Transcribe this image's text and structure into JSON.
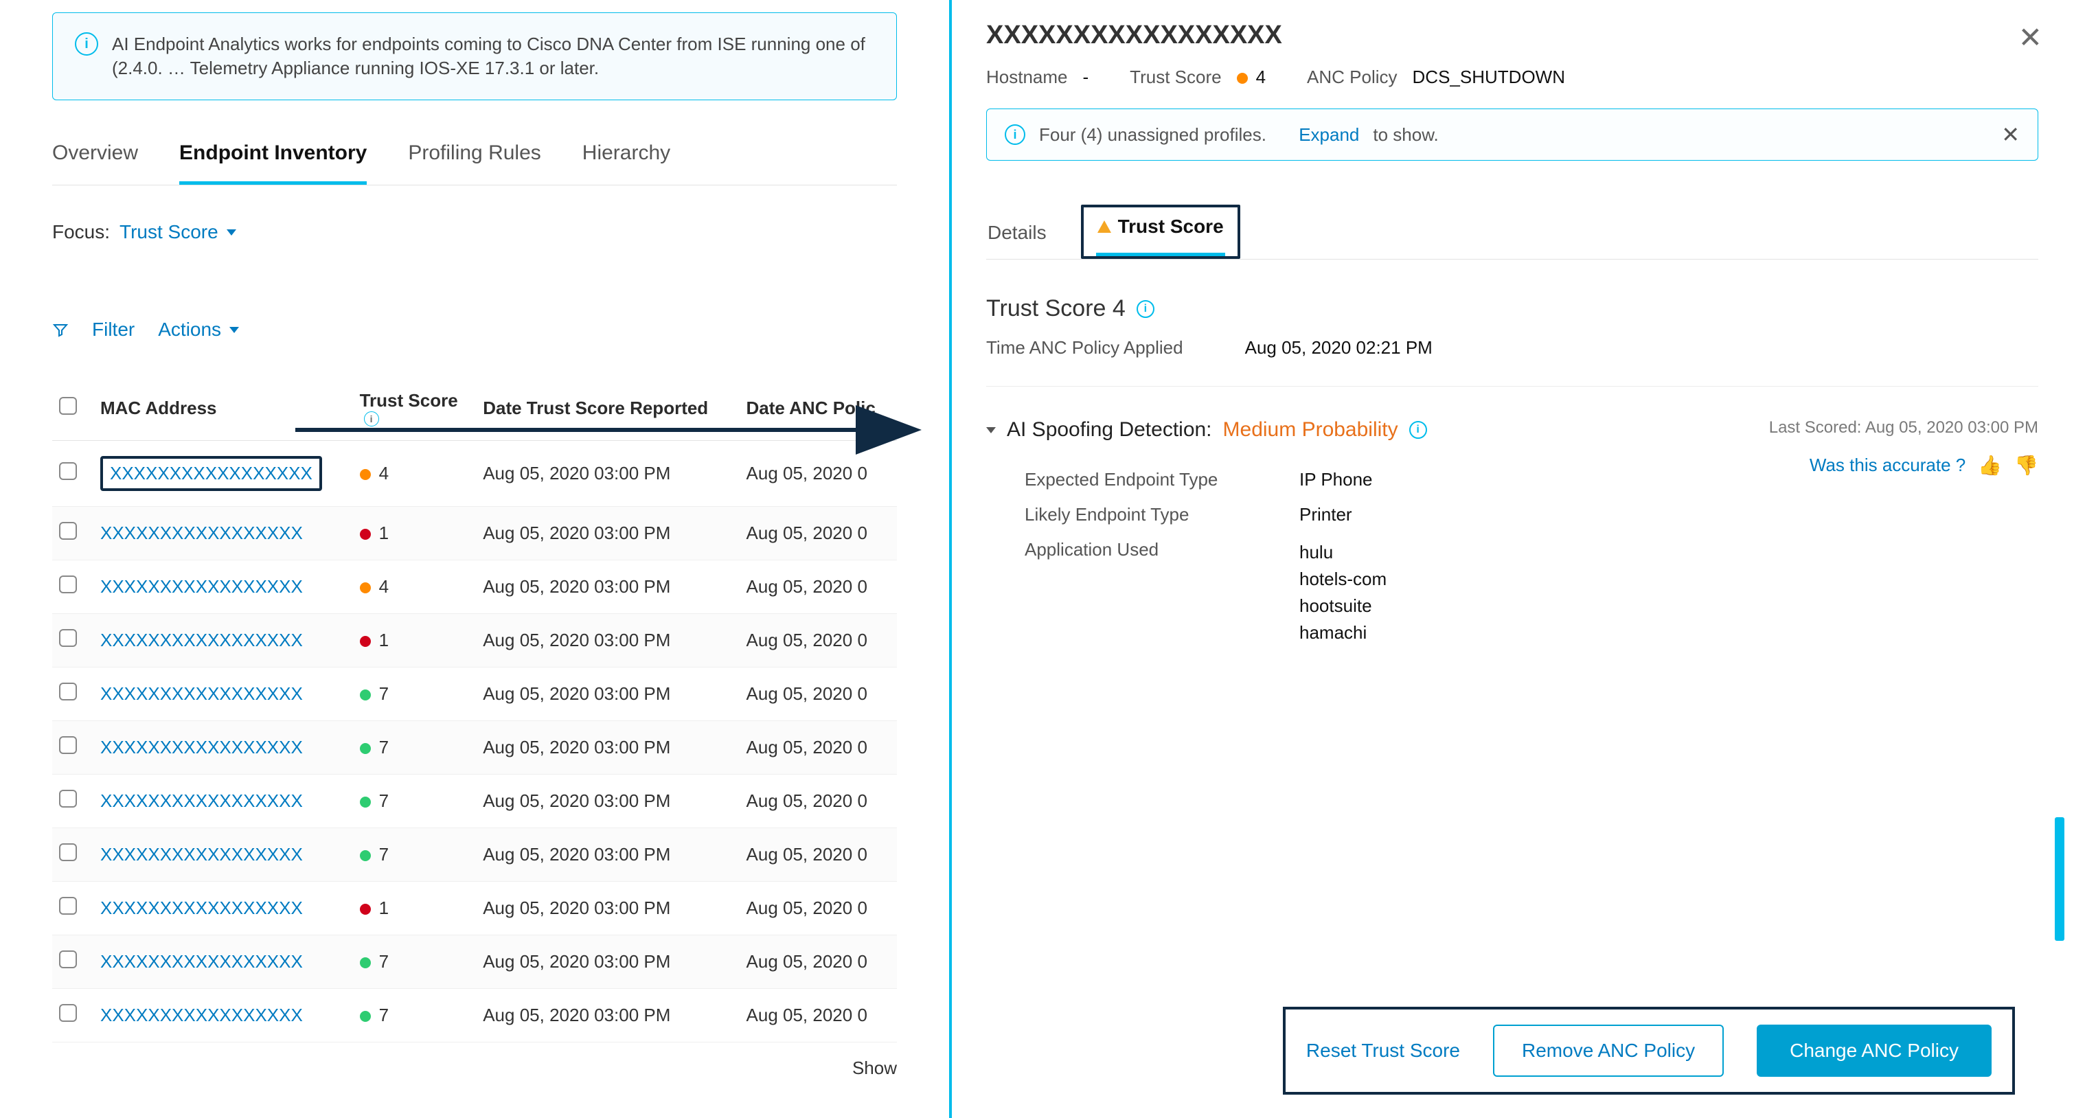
{
  "banner": {
    "text": "AI Endpoint Analytics works for endpoints coming to Cisco DNA Center from ISE running one of (2.4.0. … Telemetry Appliance running IOS-XE 17.3.1 or later."
  },
  "tabs": [
    {
      "label": "Overview",
      "active": false
    },
    {
      "label": "Endpoint Inventory",
      "active": true
    },
    {
      "label": "Profiling Rules",
      "active": false
    },
    {
      "label": "Hierarchy",
      "active": false
    }
  ],
  "focus": {
    "label": "Focus:",
    "value": "Trust Score"
  },
  "toolbar": {
    "filter": "Filter",
    "actions": "Actions"
  },
  "table": {
    "columns": [
      "MAC Address",
      "Trust Score",
      "Date Trust Score Reported",
      "Date ANC Polic"
    ],
    "rows": [
      {
        "mac": "XXXXXXXXXXXXXXXXX",
        "score": "4",
        "color": "orange",
        "reported": "Aug 05, 2020 03:00 PM",
        "anc": "Aug 05, 2020 0",
        "highlight": true
      },
      {
        "mac": "XXXXXXXXXXXXXXXXX",
        "score": "1",
        "color": "red",
        "reported": "Aug 05, 2020 03:00 PM",
        "anc": "Aug 05, 2020 0"
      },
      {
        "mac": "XXXXXXXXXXXXXXXXX",
        "score": "4",
        "color": "orange",
        "reported": "Aug 05, 2020 03:00 PM",
        "anc": "Aug 05, 2020 0"
      },
      {
        "mac": "XXXXXXXXXXXXXXXXX",
        "score": "1",
        "color": "red",
        "reported": "Aug 05, 2020 03:00 PM",
        "anc": "Aug 05, 2020 0"
      },
      {
        "mac": "XXXXXXXXXXXXXXXXX",
        "score": "7",
        "color": "green",
        "reported": "Aug 05, 2020 03:00 PM",
        "anc": "Aug 05, 2020 0"
      },
      {
        "mac": "XXXXXXXXXXXXXXXXX",
        "score": "7",
        "color": "green",
        "reported": "Aug 05, 2020 03:00 PM",
        "anc": "Aug 05, 2020 0"
      },
      {
        "mac": "XXXXXXXXXXXXXXXXX",
        "score": "7",
        "color": "green",
        "reported": "Aug 05, 2020 03:00 PM",
        "anc": "Aug 05, 2020 0"
      },
      {
        "mac": "XXXXXXXXXXXXXXXXX",
        "score": "7",
        "color": "green",
        "reported": "Aug 05, 2020 03:00 PM",
        "anc": "Aug 05, 2020 0"
      },
      {
        "mac": "XXXXXXXXXXXXXXXXX",
        "score": "1",
        "color": "red",
        "reported": "Aug 05, 2020 03:00 PM",
        "anc": "Aug 05, 2020 0"
      },
      {
        "mac": "XXXXXXXXXXXXXXXXX",
        "score": "7",
        "color": "green",
        "reported": "Aug 05, 2020 03:00 PM",
        "anc": "Aug 05, 2020 0"
      },
      {
        "mac": "XXXXXXXXXXXXXXXXX",
        "score": "7",
        "color": "green",
        "reported": "Aug 05, 2020 03:00 PM",
        "anc": "Aug 05, 2020 0"
      }
    ],
    "footer": "Show"
  },
  "panel": {
    "title": "XXXXXXXXXXXXXXXXX",
    "meta": {
      "hostname_label": "Hostname",
      "hostname_value": "-",
      "trust_label": "Trust Score",
      "trust_value": "4",
      "trust_color": "orange",
      "anc_label": "ANC Policy",
      "anc_value": "DCS_SHUTDOWN"
    },
    "notice": {
      "text": "Four (4) unassigned profiles.",
      "expand": "Expand",
      "tail": " to show."
    },
    "tabs": {
      "details": "Details",
      "trust": "Trust Score"
    },
    "trust_section": {
      "heading": "Trust Score 4",
      "applied_label": "Time ANC Policy Applied",
      "applied_value": "Aug 05, 2020 02:21 PM"
    },
    "spoof": {
      "title_prefix": "AI Spoofing Detection:",
      "probability": "Medium Probability",
      "last_scored_label": "Last Scored:",
      "last_scored_value": "Aug 05, 2020 03:00 PM",
      "accurate_label": "Was this accurate ?",
      "rows": {
        "expected_label": "Expected Endpoint Type",
        "expected_value": "IP Phone",
        "likely_label": "Likely Endpoint Type",
        "likely_value": "Printer",
        "apps_label": "Application Used"
      },
      "apps": [
        "hulu",
        "hotels-com",
        "hootsuite",
        "hamachi"
      ]
    },
    "actions": {
      "reset": "Reset Trust Score",
      "remove": "Remove ANC Policy",
      "change": "Change ANC Policy"
    }
  }
}
